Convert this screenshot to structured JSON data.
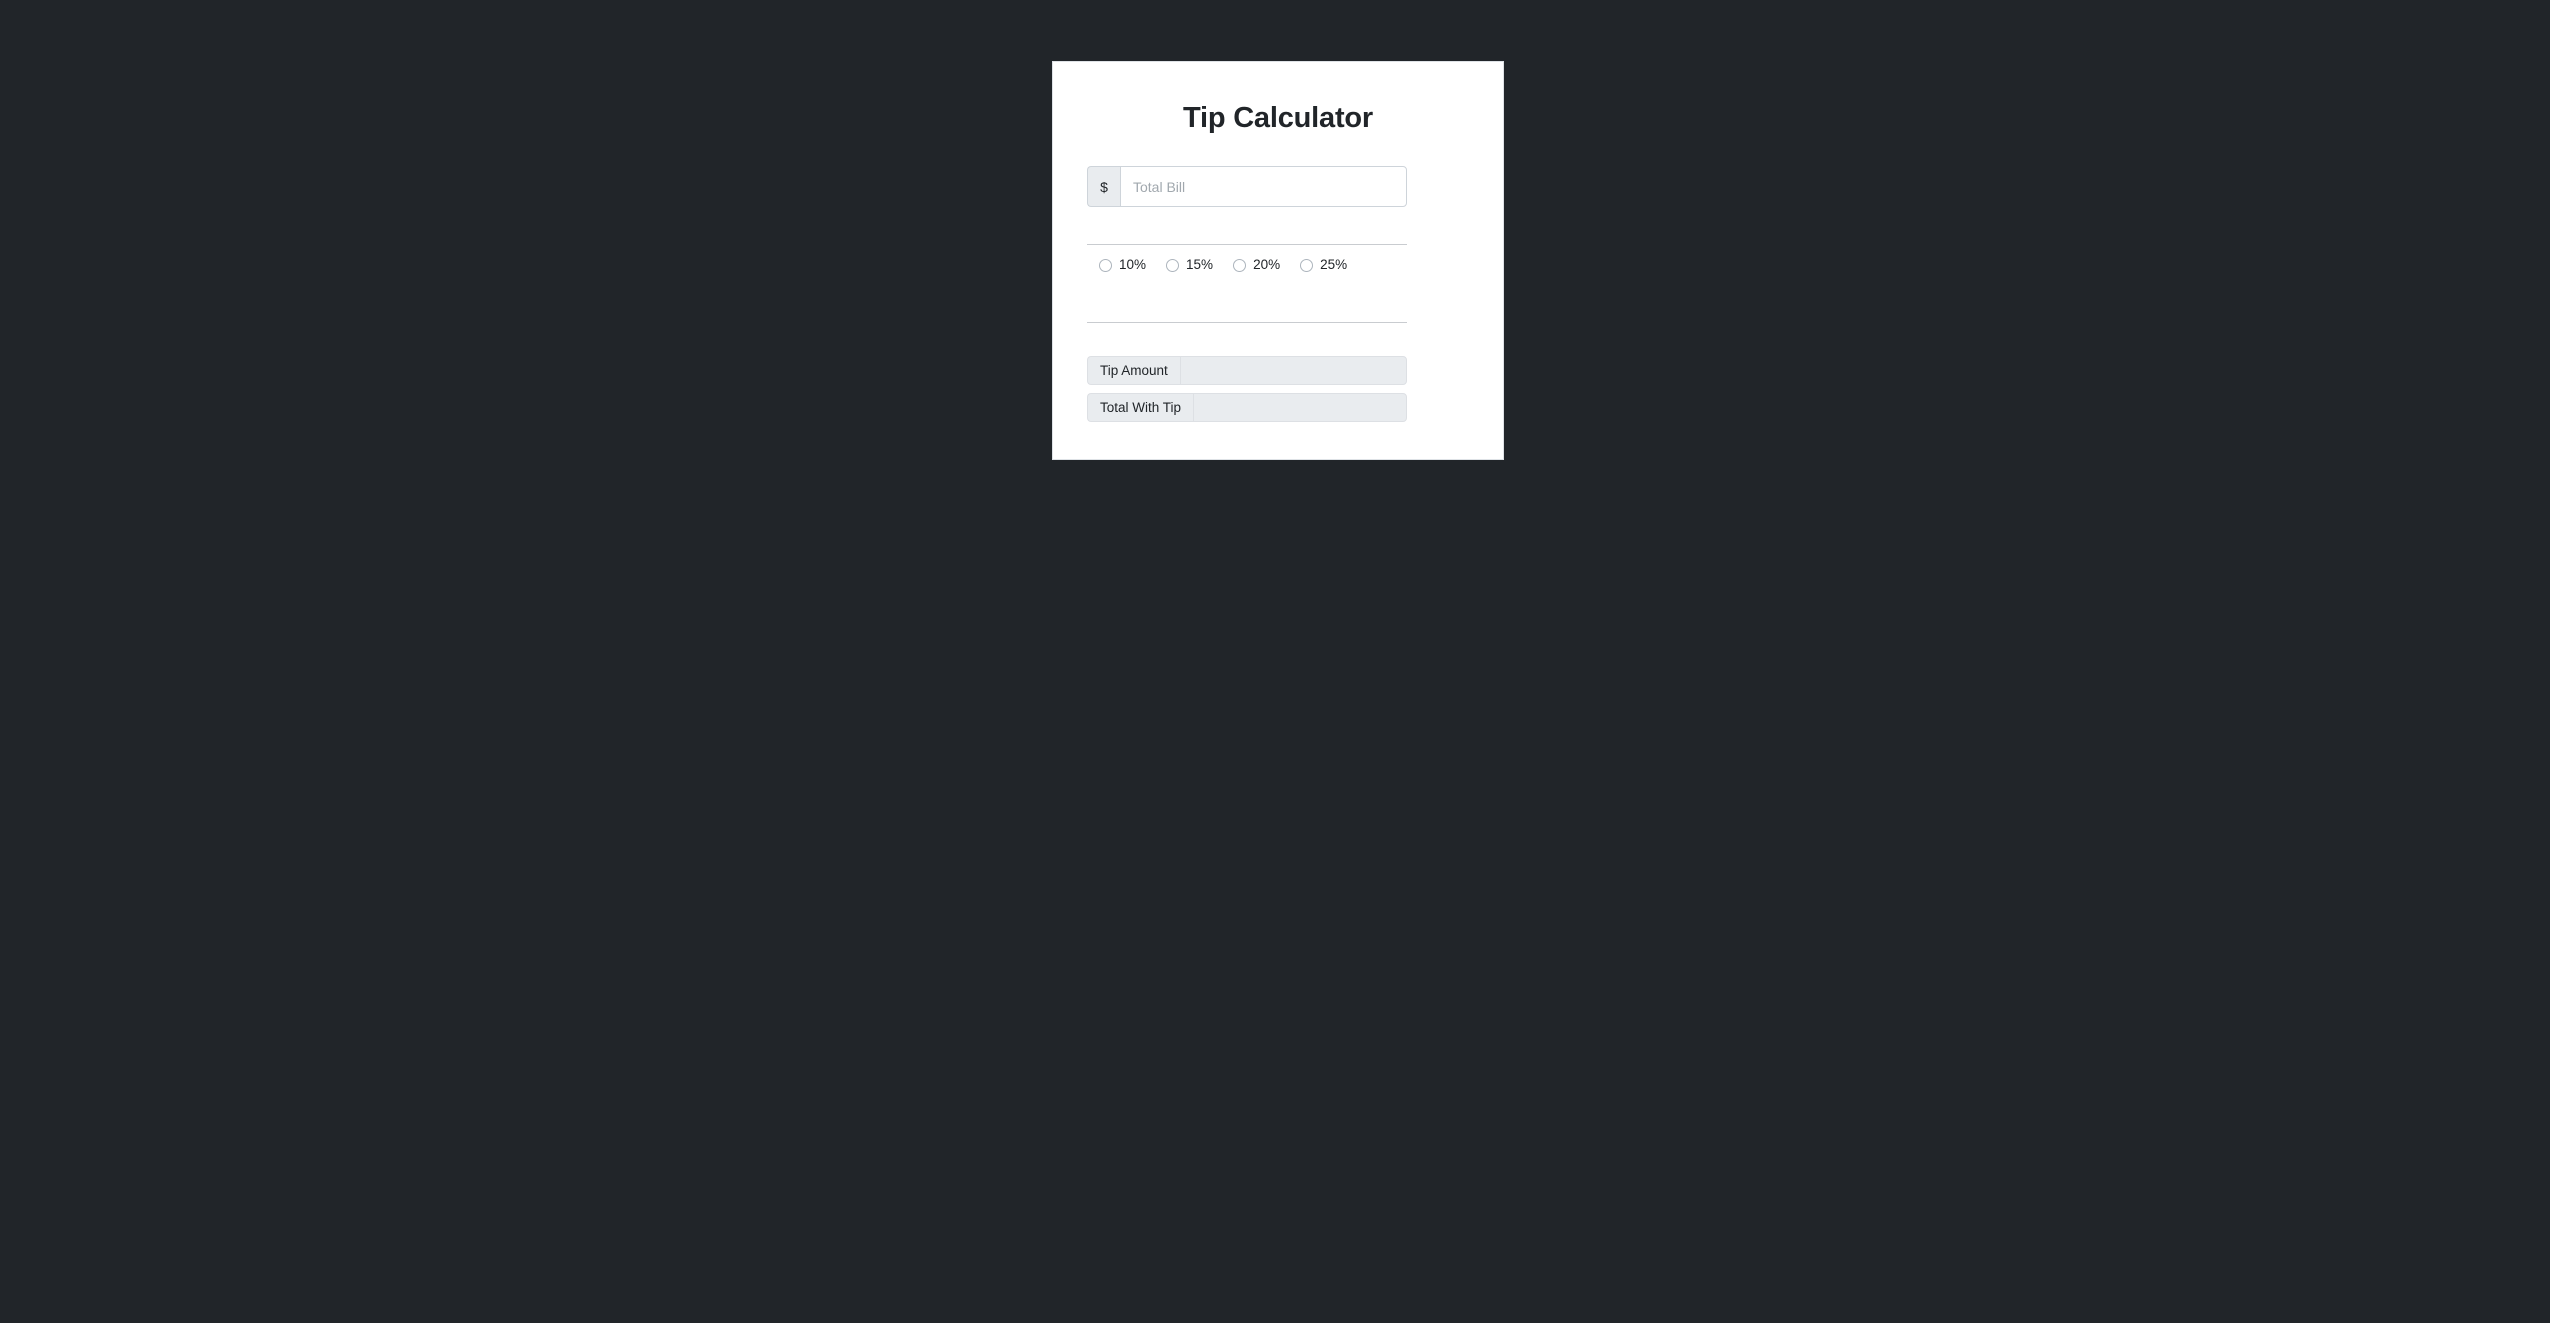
{
  "page": {
    "background_color": "#212529"
  },
  "card": {
    "background_color": "#ffffff",
    "title": "Tip Calculator"
  },
  "bill": {
    "currency_symbol": "$",
    "placeholder": "Total Bill",
    "value": ""
  },
  "tip_options": [
    {
      "label": "10%",
      "value": "10",
      "selected": false
    },
    {
      "label": "15%",
      "value": "15",
      "selected": false
    },
    {
      "label": "20%",
      "value": "20",
      "selected": false
    },
    {
      "label": "25%",
      "value": "25",
      "selected": false
    }
  ],
  "results": [
    {
      "label": "Tip Amount",
      "value": "",
      "readonly": true
    },
    {
      "label": "Total With Tip",
      "value": "",
      "readonly": true
    }
  ]
}
